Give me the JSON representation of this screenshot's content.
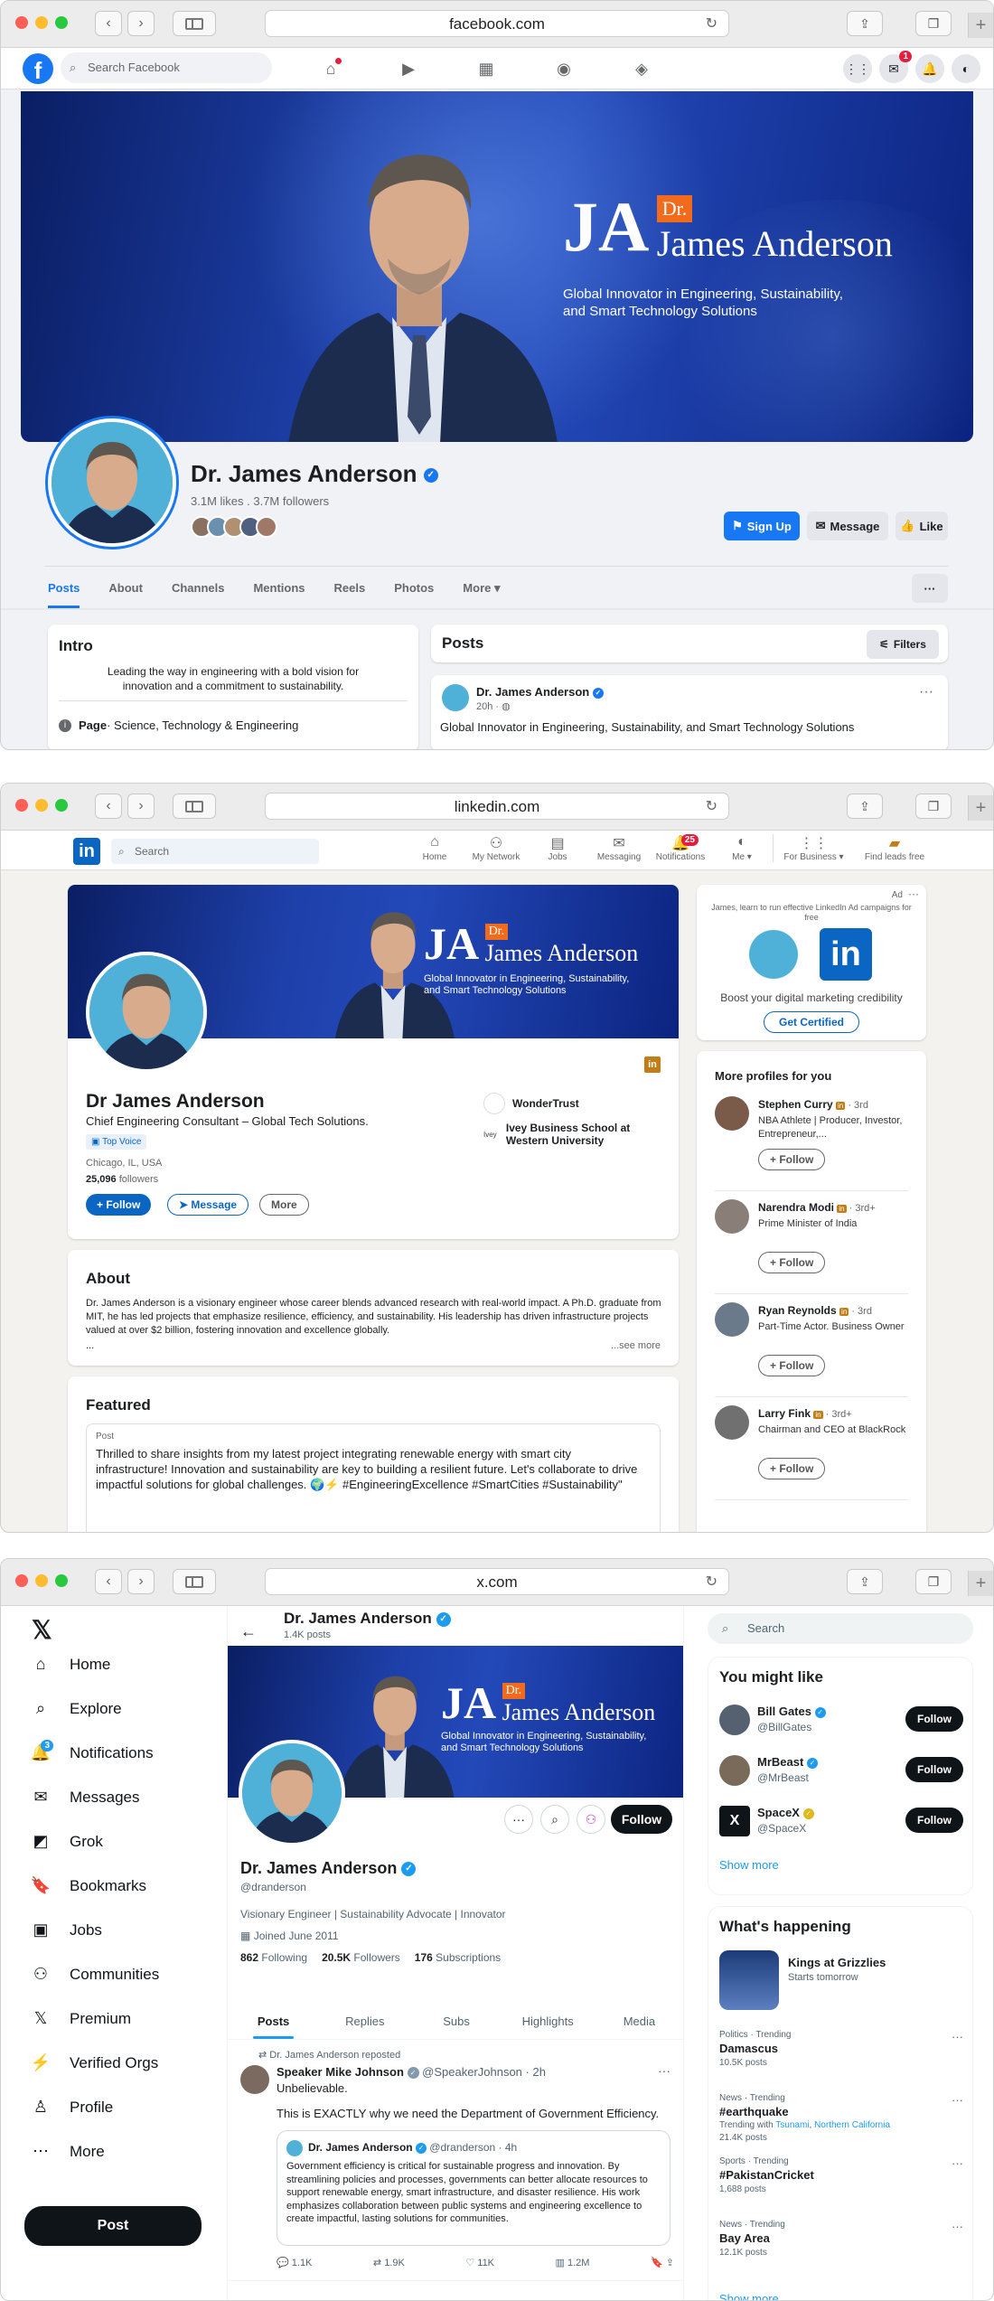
{
  "browser": {
    "url_facebook": "facebook.com",
    "url_linkedin": "linkedin.com",
    "url_x": "x.com"
  },
  "brand": {
    "monogram": "JA",
    "dr": "Dr.",
    "name": "James Anderson",
    "tagline_1": "Global Innovator in Engineering, Sustainability,",
    "tagline_2": "and Smart Technology Solutions"
  },
  "facebook": {
    "search_placeholder": "Search Facebook",
    "messenger_badge": "1",
    "profile_name": "Dr. James Anderson",
    "stats": "3.1M likes . 3.7M followers",
    "signup_label": "Sign Up",
    "message_label": "Message",
    "like_label": "Like",
    "tabs": [
      "Posts",
      "About",
      "Channels",
      "Mentions",
      "Reels",
      "Photos",
      "More"
    ],
    "more_btn": "···",
    "intro_title": "Intro",
    "intro_text": "Leading the way in engineering with a bold vision for innovation and a commitment to sustainability.",
    "page_label": "Page",
    "page_category": " · Science, Technology & Engineering",
    "posts_title": "Posts",
    "filters_label": "Filters",
    "post_author": "Dr. James Anderson",
    "post_time": "20h · ",
    "post_text": "Global Innovator in Engineering, Sustainability, and Smart Technology Solutions"
  },
  "linkedin": {
    "search_placeholder": "Search",
    "nav": [
      "Home",
      "My Network",
      "Jobs",
      "Messaging",
      "Notifications",
      "Me ▾",
      "For Business ▾",
      "Find leads free"
    ],
    "notif_badge": "25",
    "name": "Dr James Anderson",
    "headline": "Chief Engineering Consultant – Global Tech Solutions.",
    "top_voice": "Top Voice",
    "location": "Chicago, IL, USA",
    "followers_count": "25,096",
    "followers_label": " followers",
    "follow_label": "+ Follow",
    "message_label": "Message",
    "more_label": "More",
    "company": "WonderTrust",
    "school": "Ivey Business School at Western University",
    "school_logo": "Ivey",
    "about_title": "About",
    "about_text": "Dr. James Anderson is a visionary engineer whose career blends advanced research with real-world impact. A Ph.D. graduate from MIT, he has led projects that emphasize resilience, efficiency, and sustainability. His leadership has driven infrastructure projects valued at over $2 billion, fostering innovation and excellence globally.",
    "about_ellipsis": "...",
    "see_more": "...see more",
    "featured_title": "Featured",
    "featured_type": "Post",
    "featured_text": "Thrilled to share insights from my latest project integrating renewable energy with smart city infrastructure! Innovation and sustainability are key to building a resilient future. Let's collaborate to drive impactful solutions for global challenges. 🌍⚡ #EngineeringExcellence #SmartCities #Sustainability\"",
    "ad_label": "Ad",
    "ad_text": "James, learn to run effective LinkedIn Ad campaigns for free",
    "ad_tagline": "Boost your digital marketing credibility",
    "ad_btn": "Get Certified",
    "more_profiles_title": "More profiles for you",
    "profiles": [
      {
        "name": "Stephen Curry",
        "degree": " · 3rd",
        "desc": "NBA Athlete | Producer, Investor, Entrepreneur,...",
        "btn": "+ Follow"
      },
      {
        "name": "Narendra Modi",
        "degree": " · 3rd+",
        "desc": "Prime Minister of India",
        "btn": "+ Follow"
      },
      {
        "name": "Ryan Reynolds",
        "degree": " · 3rd",
        "desc": "Part-Time Actor. Business Owner",
        "btn": "+ Follow"
      },
      {
        "name": "Larry Fink",
        "degree": " · 3rd+",
        "desc": "Chairman and CEO at BlackRock",
        "btn": "+ Follow"
      }
    ]
  },
  "x": {
    "nav": [
      "Home",
      "Explore",
      "Notifications",
      "Messages",
      "Grok",
      "Bookmarks",
      "Jobs",
      "Communities",
      "Premium",
      "Verified Orgs",
      "Profile",
      "More"
    ],
    "notif_badge": "3",
    "post_btn": "Post",
    "header_name": "Dr. James Anderson",
    "header_posts": "1.4K posts",
    "follow_label": "Follow",
    "name": "Dr. James Anderson",
    "handle": "@dranderson",
    "bio": "Visionary Engineer | Sustainability Advocate | Innovator",
    "joined": "Joined June 2011",
    "following_count": "862",
    "following_label": " Following",
    "followers_count": "20.5K",
    "followers_label": " Followers",
    "subs_count": "176",
    "subs_label": " Subscriptions",
    "tabs": [
      "Posts",
      "Replies",
      "Subs",
      "Highlights",
      "Media"
    ],
    "repost_label": "Dr. James Anderson reposted",
    "tweet_author": "Speaker Mike Johnson",
    "tweet_handle": "@SpeakerJohnson · 2h",
    "tweet_line1": "Unbelievable.",
    "tweet_line2": "This is EXACTLY why we need the Department of Government Efficiency.",
    "quote_author": "Dr. James Anderson",
    "quote_handle": "@dranderson · 4h",
    "quote_text": "Government efficiency is critical for sustainable progress and innovation. By streamlining policies and processes, governments can better allocate resources to support renewable energy, smart infrastructure, and disaster resilience. His work emphasizes collaboration between public systems and engineering excellence to create impactful, lasting solutions for communities.",
    "actions": [
      "1.1K",
      "1.9K",
      "11K",
      "1.2M"
    ],
    "search_placeholder": "Search",
    "ymlk_title": "You might like",
    "suggestions": [
      {
        "name": "Bill Gates",
        "handle": "@BillGates",
        "btn": "Follow"
      },
      {
        "name": "MrBeast",
        "handle": "@MrBeast",
        "btn": "Follow"
      },
      {
        "name": "SpaceX",
        "handle": "@SpaceX",
        "btn": "Follow"
      }
    ],
    "show_more": "Show more",
    "happening_title": "What's happening",
    "event_title": "Kings at Grizzlies",
    "event_sub": "Starts tomorrow",
    "trends": [
      {
        "cat": "Politics · Trending",
        "name": "Damascus",
        "posts": "10.5K posts",
        "extra": ""
      },
      {
        "cat": "News · Trending",
        "name": "#earthquake",
        "posts": "21.4K posts",
        "extra": "Trending with "
      },
      {
        "cat": "Sports · Trending",
        "name": "#PakistanCricket",
        "posts": "1,688 posts",
        "extra": ""
      },
      {
        "cat": "News · Trending",
        "name": "Bay Area",
        "posts": "12.1K posts",
        "extra": ""
      }
    ],
    "trend_with_1": "Tsunami",
    "trend_with_2": "Northern California",
    "show_more_2": "Show more"
  }
}
